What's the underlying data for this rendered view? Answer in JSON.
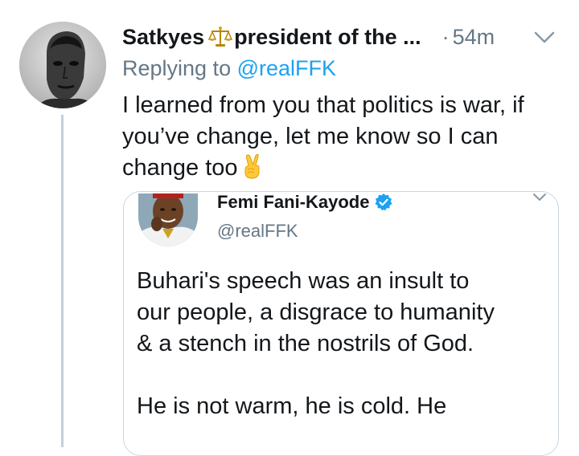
{
  "reply": {
    "display_name": "Satkyes",
    "name_emoji": "scales-icon",
    "name_rest": "president of the ...",
    "separator": "·",
    "timestamp": "54m",
    "replying_prefix": "Replying to",
    "replying_handle": "@realFFK",
    "text_lines": [
      "I learned from you that politics is war, if",
      "you’ve change, let me know so I can",
      "change too"
    ],
    "text_emoji": "victory-hand-icon"
  },
  "quote": {
    "display_name": "Femi Fani-Kayode",
    "verified": true,
    "handle": "@realFFK",
    "paragraph_1_lines": [
      "Buhari's speech was an insult to",
      "our people, a disgrace to humanity",
      "& a stench in the nostrils of God."
    ],
    "paragraph_2_lines": [
      "He is not warm, he is cold. He"
    ]
  },
  "colors": {
    "text": "#14171a",
    "secondary": "#657786",
    "link": "#1da1f2",
    "border": "#ccd6dd",
    "thread_line": "#c4cfd6",
    "verified": "#1da1f2"
  }
}
